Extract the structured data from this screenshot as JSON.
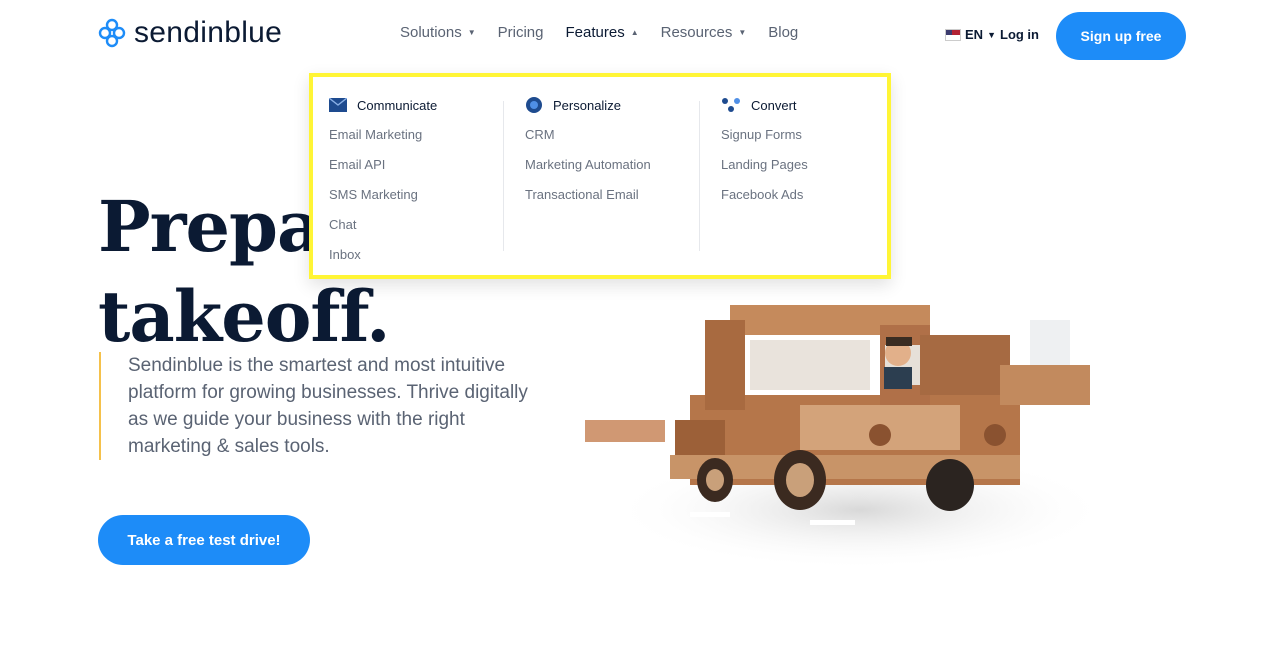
{
  "header": {
    "logo_text": "sendinblue",
    "nav": [
      {
        "label": "Solutions",
        "has_caret": true
      },
      {
        "label": "Pricing",
        "has_caret": false
      },
      {
        "label": "Features",
        "has_caret": true
      },
      {
        "label": "Resources",
        "has_caret": true
      },
      {
        "label": "Blog",
        "has_caret": false
      }
    ],
    "language": "EN",
    "login": "Log in",
    "signup": "Sign up free"
  },
  "dropdown": {
    "columns": [
      {
        "title": "Communicate",
        "icon": "envelope-icon",
        "items": [
          "Email Marketing",
          "Email API",
          "SMS Marketing",
          "Chat",
          "Inbox"
        ]
      },
      {
        "title": "Personalize",
        "icon": "target-icon",
        "items": [
          "CRM",
          "Marketing Automation",
          "Transactional Email"
        ]
      },
      {
        "title": "Convert",
        "icon": "dots-icon",
        "items": [
          "Signup Forms",
          "Landing Pages",
          "Facebook Ads"
        ]
      }
    ]
  },
  "hero": {
    "title_line1": "Prepar",
    "title_line2": "takeoff.",
    "description": "Sendinblue is the smartest and most intuitive platform for growing businesses. Thrive digitally as we guide your business with the right marketing & sales tools.",
    "cta": "Take a free test drive!"
  },
  "colors": {
    "brand_blue": "#1d8cf8",
    "navy": "#0b1a33",
    "highlight_yellow": "#fff535",
    "accent_bar": "#f5c14b"
  }
}
